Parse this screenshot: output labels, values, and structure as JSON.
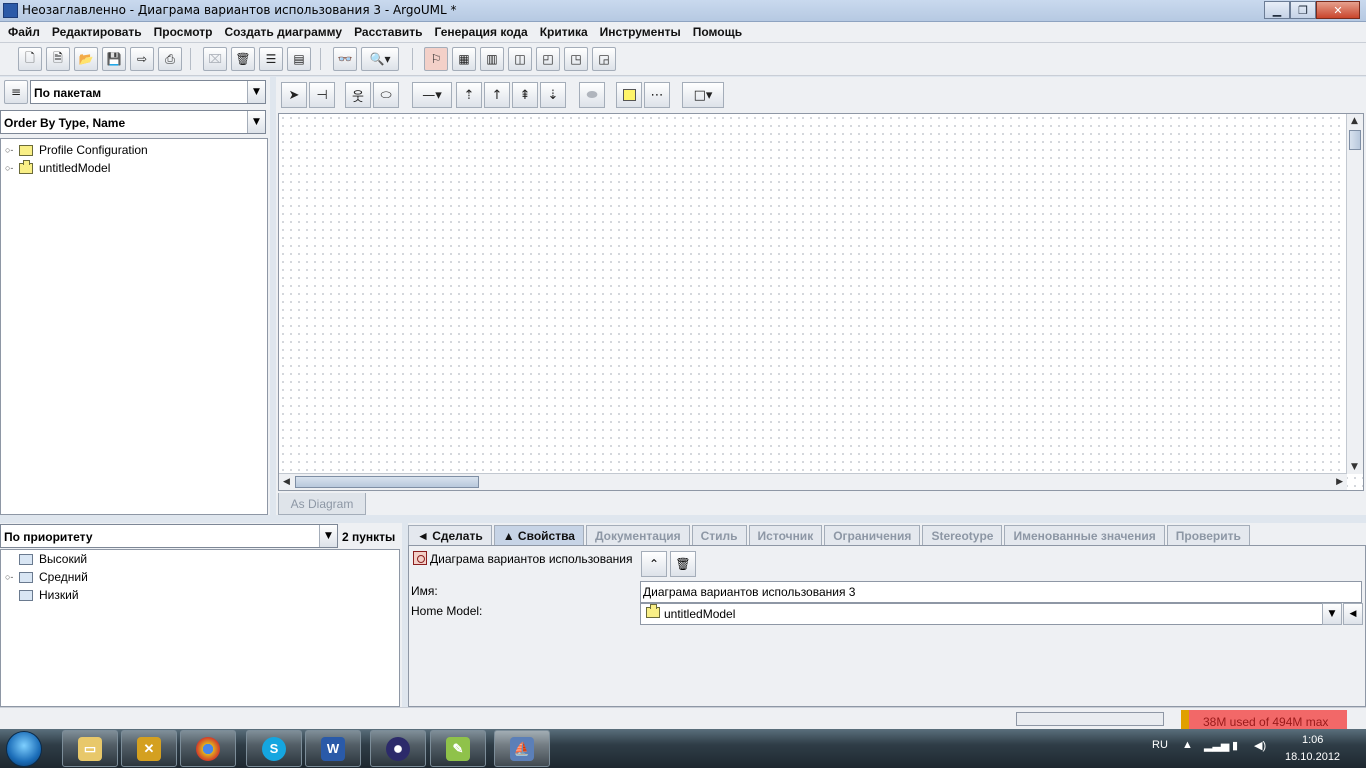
{
  "window": {
    "title": "Неозаглавленно - Диаграма вариантов использования 3 - ArgoUML *"
  },
  "menu": [
    "Файл",
    "Редактировать",
    "Просмотр",
    "Создать диаграмму",
    "Расставить",
    "Генерация кода",
    "Критика",
    "Инструменты",
    "Помощь"
  ],
  "explorer": {
    "perspective": "По пакетам",
    "order": "Order By Type, Name",
    "tree": [
      {
        "label": "Profile Configuration",
        "icon": "folder-icon"
      },
      {
        "label": "untitledModel",
        "icon": "model-icon"
      }
    ]
  },
  "diagram": {
    "tab_label": "As Diagram"
  },
  "todo": {
    "grouping": "По приоритету",
    "count": "2 пункты",
    "items": [
      {
        "label": "Высокий",
        "expandable": false
      },
      {
        "label": "Средний",
        "expandable": true
      },
      {
        "label": "Низкий",
        "expandable": false
      }
    ]
  },
  "details": {
    "tabs": [
      {
        "label": "◄ Сделать",
        "state": "enabled"
      },
      {
        "label": "▲ Свойства",
        "state": "active"
      },
      {
        "label": "Документация",
        "state": "disabled"
      },
      {
        "label": "Стиль",
        "state": "disabled"
      },
      {
        "label": "Источник",
        "state": "disabled"
      },
      {
        "label": "Ограничения",
        "state": "disabled"
      },
      {
        "label": "Stereotype",
        "state": "disabled"
      },
      {
        "label": "Именованные значения",
        "state": "disabled"
      },
      {
        "label": "Проверить",
        "state": "disabled"
      }
    ],
    "header": "Диаграма вариантов использования",
    "name_label": "Имя:",
    "name_value": "Диаграма вариантов использования 3",
    "home_model_label": "Home Model:",
    "home_model_value": "untitledModel"
  },
  "status": {
    "memory": "38M used of 494M max",
    "memory_used_fraction": 0.077
  },
  "tray": {
    "lang": "RU",
    "time": "1:06",
    "date": "18.10.2012"
  },
  "colors": {
    "memory_bg": "#f26868",
    "active_tab": "#c7d4e6",
    "note_yellow": "#fef46a"
  }
}
